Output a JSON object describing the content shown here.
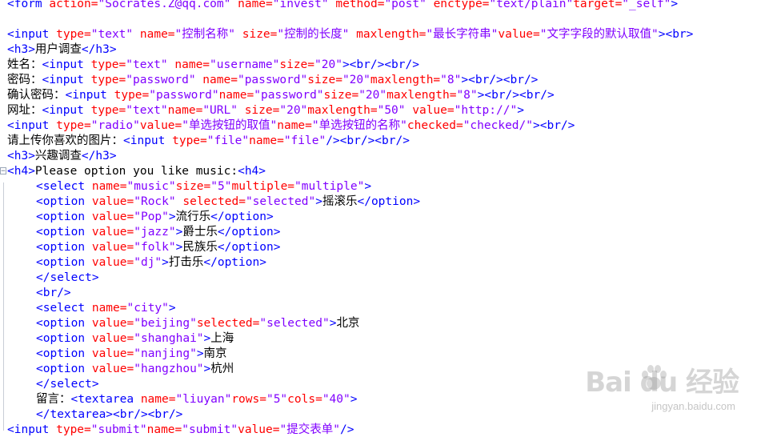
{
  "editor": {
    "lines": [
      [
        {
          "c": "tag",
          "t": "<form "
        },
        {
          "c": "attr",
          "t": "action="
        },
        {
          "c": "val",
          "t": "\"Socrates.Z@qq.com\""
        },
        {
          "c": "attr",
          "t": " name="
        },
        {
          "c": "val",
          "t": "\"invest\""
        },
        {
          "c": "attr",
          "t": " method="
        },
        {
          "c": "val",
          "t": "\"post\""
        },
        {
          "c": "attr",
          "t": " enctype="
        },
        {
          "c": "val",
          "t": "\"text/plain\""
        },
        {
          "c": "attr",
          "t": "target="
        },
        {
          "c": "val",
          "t": "\"_self\""
        },
        {
          "c": "tag",
          "t": ">"
        }
      ],
      [],
      [
        {
          "c": "tag",
          "t": "<input "
        },
        {
          "c": "attr",
          "t": "type="
        },
        {
          "c": "val",
          "t": "\"text\""
        },
        {
          "c": "attr",
          "t": " name="
        },
        {
          "c": "val",
          "t": "\"控制名称\""
        },
        {
          "c": "attr",
          "t": " size="
        },
        {
          "c": "val",
          "t": "\"控制的长度\""
        },
        {
          "c": "attr",
          "t": " maxlength="
        },
        {
          "c": "val",
          "t": "\"最长字符串\""
        },
        {
          "c": "attr",
          "t": "value="
        },
        {
          "c": "val",
          "t": "\"文字字段的默认取值\""
        },
        {
          "c": "tag",
          "t": "><br>"
        }
      ],
      [
        {
          "c": "tag",
          "t": "<h3>"
        },
        {
          "c": "txt",
          "t": "用户调查"
        },
        {
          "c": "tag",
          "t": "</h3>"
        }
      ],
      [
        {
          "c": "txt",
          "t": "姓名："
        },
        {
          "c": "tag",
          "t": "<input "
        },
        {
          "c": "attr",
          "t": "type="
        },
        {
          "c": "val",
          "t": "\"text\""
        },
        {
          "c": "attr",
          "t": " name="
        },
        {
          "c": "val",
          "t": "\"username\""
        },
        {
          "c": "attr",
          "t": "size="
        },
        {
          "c": "val",
          "t": "\"20\""
        },
        {
          "c": "tag",
          "t": "><br/><br/>"
        }
      ],
      [
        {
          "c": "txt",
          "t": "密码："
        },
        {
          "c": "tag",
          "t": "<input "
        },
        {
          "c": "attr",
          "t": "type="
        },
        {
          "c": "val",
          "t": "\"password\""
        },
        {
          "c": "attr",
          "t": " name="
        },
        {
          "c": "val",
          "t": "\"password\""
        },
        {
          "c": "attr",
          "t": "size="
        },
        {
          "c": "val",
          "t": "\"20\""
        },
        {
          "c": "attr",
          "t": "maxlength="
        },
        {
          "c": "val",
          "t": "\"8\""
        },
        {
          "c": "tag",
          "t": "><br/><br/>"
        }
      ],
      [
        {
          "c": "txt",
          "t": "确认密码："
        },
        {
          "c": "tag",
          "t": "<input "
        },
        {
          "c": "attr",
          "t": "type="
        },
        {
          "c": "val",
          "t": "\"password\""
        },
        {
          "c": "attr",
          "t": "name="
        },
        {
          "c": "val",
          "t": "\"password\""
        },
        {
          "c": "attr",
          "t": "size="
        },
        {
          "c": "val",
          "t": "\"20\""
        },
        {
          "c": "attr",
          "t": "maxlength="
        },
        {
          "c": "val",
          "t": "\"8\""
        },
        {
          "c": "tag",
          "t": "><br/><br/>"
        }
      ],
      [
        {
          "c": "txt",
          "t": "网址："
        },
        {
          "c": "tag",
          "t": "<input "
        },
        {
          "c": "attr",
          "t": "type="
        },
        {
          "c": "val",
          "t": "\"text\""
        },
        {
          "c": "attr",
          "t": "name="
        },
        {
          "c": "val",
          "t": "\"URL\""
        },
        {
          "c": "attr",
          "t": " size="
        },
        {
          "c": "val",
          "t": "\"20\""
        },
        {
          "c": "attr",
          "t": "maxlength="
        },
        {
          "c": "val",
          "t": "\"50\""
        },
        {
          "c": "attr",
          "t": " value="
        },
        {
          "c": "val",
          "t": "\"http://\""
        },
        {
          "c": "tag",
          "t": ">"
        }
      ],
      [
        {
          "c": "tag",
          "t": "<input "
        },
        {
          "c": "attr",
          "t": "type="
        },
        {
          "c": "val",
          "t": "\"radio\""
        },
        {
          "c": "attr",
          "t": "value="
        },
        {
          "c": "val",
          "t": "\"单选按钮的取值\""
        },
        {
          "c": "attr",
          "t": "name="
        },
        {
          "c": "val",
          "t": "\"单选按钮的名称\""
        },
        {
          "c": "attr",
          "t": "checked="
        },
        {
          "c": "val",
          "t": "\"checked/\""
        },
        {
          "c": "tag",
          "t": "><br/>"
        }
      ],
      [
        {
          "c": "txt",
          "t": "请上传你喜欢的图片："
        },
        {
          "c": "tag",
          "t": "<input "
        },
        {
          "c": "attr",
          "t": "type="
        },
        {
          "c": "val",
          "t": "\"file\""
        },
        {
          "c": "attr",
          "t": "name="
        },
        {
          "c": "val",
          "t": "\"file\""
        },
        {
          "c": "tag",
          "t": "/><br/><br/>"
        }
      ],
      [
        {
          "c": "tag",
          "t": "<h3>"
        },
        {
          "c": "txt",
          "t": "兴趣调查"
        },
        {
          "c": "tag",
          "t": "</h3>"
        }
      ],
      [
        {
          "c": "tag",
          "t": "<h4>"
        },
        {
          "c": "txt",
          "t": "Please option you like music:"
        },
        {
          "c": "tag",
          "t": "<h4>"
        }
      ],
      [
        {
          "c": "tag",
          "t": "<select "
        },
        {
          "c": "attr",
          "t": "name="
        },
        {
          "c": "val",
          "t": "\"music\""
        },
        {
          "c": "attr",
          "t": "size="
        },
        {
          "c": "val",
          "t": "\"5\""
        },
        {
          "c": "attr",
          "t": "multiple="
        },
        {
          "c": "val",
          "t": "\"multiple\""
        },
        {
          "c": "tag",
          "t": ">"
        }
      ],
      [
        {
          "c": "tag",
          "t": "<option "
        },
        {
          "c": "attr",
          "t": "value="
        },
        {
          "c": "val",
          "t": "\"Rock\""
        },
        {
          "c": "attr",
          "t": " selected="
        },
        {
          "c": "val",
          "t": "\"selected\""
        },
        {
          "c": "tag",
          "t": ">"
        },
        {
          "c": "txt",
          "t": "摇滚乐"
        },
        {
          "c": "tag",
          "t": "</option>"
        }
      ],
      [
        {
          "c": "tag",
          "t": "<option "
        },
        {
          "c": "attr",
          "t": "value="
        },
        {
          "c": "val",
          "t": "\"Pop\""
        },
        {
          "c": "tag",
          "t": ">"
        },
        {
          "c": "txt",
          "t": "流行乐"
        },
        {
          "c": "tag",
          "t": "</option>"
        }
      ],
      [
        {
          "c": "tag",
          "t": "<option "
        },
        {
          "c": "attr",
          "t": "value="
        },
        {
          "c": "val",
          "t": "\"jazz\""
        },
        {
          "c": "tag",
          "t": ">"
        },
        {
          "c": "txt",
          "t": "爵士乐"
        },
        {
          "c": "tag",
          "t": "</option>"
        }
      ],
      [
        {
          "c": "tag",
          "t": "<option "
        },
        {
          "c": "attr",
          "t": "value="
        },
        {
          "c": "val",
          "t": "\"folk\""
        },
        {
          "c": "tag",
          "t": ">"
        },
        {
          "c": "txt",
          "t": "民族乐"
        },
        {
          "c": "tag",
          "t": "</option>"
        }
      ],
      [
        {
          "c": "tag",
          "t": "<option "
        },
        {
          "c": "attr",
          "t": "value="
        },
        {
          "c": "val",
          "t": "\"dj\""
        },
        {
          "c": "tag",
          "t": ">"
        },
        {
          "c": "txt",
          "t": "打击乐"
        },
        {
          "c": "tag",
          "t": "</option>"
        }
      ],
      [
        {
          "c": "tag",
          "t": "</select>"
        }
      ],
      [
        {
          "c": "tag",
          "t": "<br/>"
        }
      ],
      [
        {
          "c": "tag",
          "t": "<select "
        },
        {
          "c": "attr",
          "t": "name="
        },
        {
          "c": "val",
          "t": "\"city\""
        },
        {
          "c": "tag",
          "t": ">"
        }
      ],
      [
        {
          "c": "tag",
          "t": "<option "
        },
        {
          "c": "attr",
          "t": "value="
        },
        {
          "c": "val",
          "t": "\"beijing\""
        },
        {
          "c": "attr",
          "t": "selected="
        },
        {
          "c": "val",
          "t": "\"selected\""
        },
        {
          "c": "tag",
          "t": ">"
        },
        {
          "c": "txt",
          "t": "北京"
        }
      ],
      [
        {
          "c": "tag",
          "t": "<option "
        },
        {
          "c": "attr",
          "t": "value="
        },
        {
          "c": "val",
          "t": "\"shanghai\""
        },
        {
          "c": "tag",
          "t": ">"
        },
        {
          "c": "txt",
          "t": "上海"
        }
      ],
      [
        {
          "c": "tag",
          "t": "<option "
        },
        {
          "c": "attr",
          "t": "value="
        },
        {
          "c": "val",
          "t": "\"nanjing\""
        },
        {
          "c": "tag",
          "t": ">"
        },
        {
          "c": "txt",
          "t": "南京"
        }
      ],
      [
        {
          "c": "tag",
          "t": "<option "
        },
        {
          "c": "attr",
          "t": "value="
        },
        {
          "c": "val",
          "t": "\"hangzhou\""
        },
        {
          "c": "tag",
          "t": ">"
        },
        {
          "c": "txt",
          "t": "杭州"
        }
      ],
      [
        {
          "c": "tag",
          "t": "</select>"
        }
      ],
      [
        {
          "c": "txt",
          "t": "留言："
        },
        {
          "c": "tag",
          "t": "<textarea "
        },
        {
          "c": "attr",
          "t": "name="
        },
        {
          "c": "val",
          "t": "\"liuyan\""
        },
        {
          "c": "attr",
          "t": "rows="
        },
        {
          "c": "val",
          "t": "\"5\""
        },
        {
          "c": "attr",
          "t": "cols="
        },
        {
          "c": "val",
          "t": "\"40\""
        },
        {
          "c": "tag",
          "t": ">"
        }
      ],
      [
        {
          "c": "tag",
          "t": "</textarea><br/><br/>"
        }
      ],
      [
        {
          "c": "tag",
          "t": "<input "
        },
        {
          "c": "attr",
          "t": "type="
        },
        {
          "c": "val",
          "t": "\"submit\""
        },
        {
          "c": "attr",
          "t": "name="
        },
        {
          "c": "val",
          "t": "\"submit\""
        },
        {
          "c": "attr",
          "t": "value="
        },
        {
          "c": "val",
          "t": "\"提交表单\""
        },
        {
          "c": "tag",
          "t": "/>"
        }
      ]
    ],
    "indented_lines": [
      12,
      13,
      14,
      15,
      16,
      17,
      18,
      19,
      20,
      21,
      22,
      23,
      24,
      25,
      26,
      27
    ],
    "fold_marker_line": 11,
    "fold_marker_symbol": "⊟",
    "colors": {
      "tag": "#0000ff",
      "attribute": "#ff0000",
      "value": "#8000ff",
      "text": "#000000"
    }
  },
  "watermark": {
    "brand": "Bai du 经验",
    "url": "jingyan.baidu.com"
  }
}
